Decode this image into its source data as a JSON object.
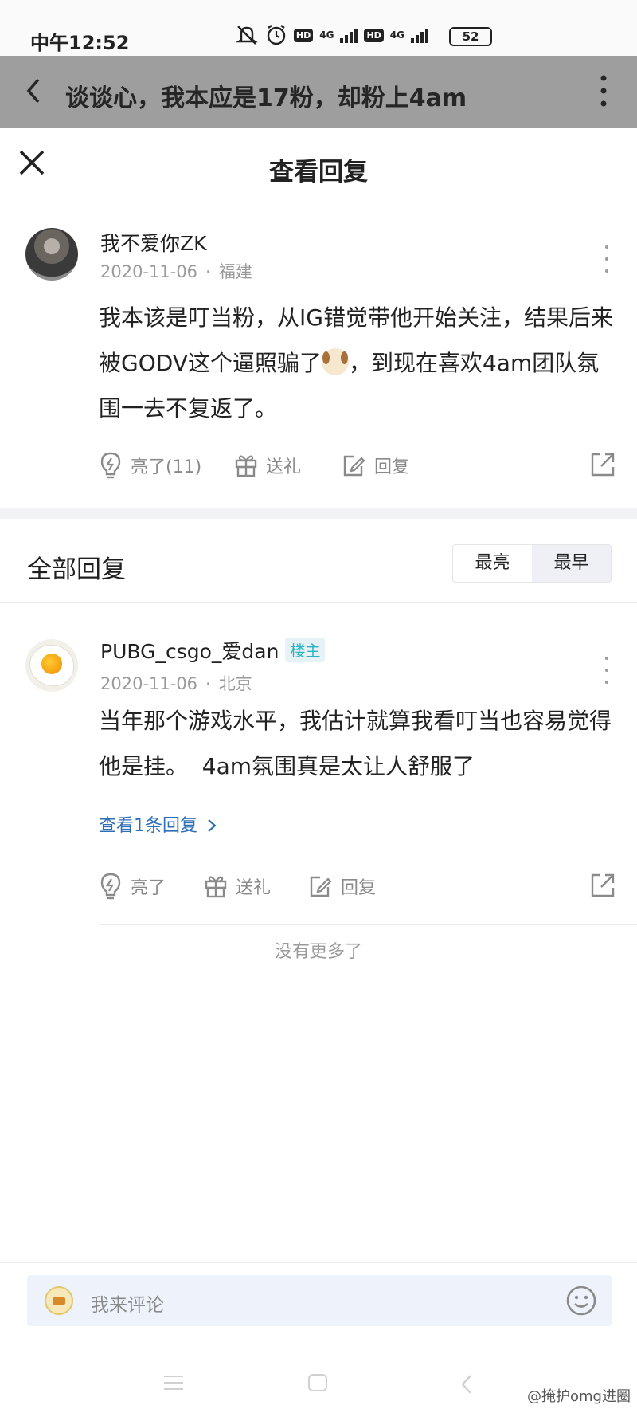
{
  "status_bar": {
    "time": "中午12:52",
    "hd1": "HD",
    "net1": "4G",
    "hd2": "HD",
    "net2": "4G",
    "battery": "52"
  },
  "page_header": {
    "title": "谈谈心，我本应是17粉，却粉上4am"
  },
  "sheet": {
    "title": "查看回复"
  },
  "main_comment": {
    "username": "我不爱你ZK",
    "date": "2020-11-06",
    "location": "福建",
    "text_before_emoji": "我本该是叮当粉，从IG错觉带他开始关注，结果后来被GODV这个逼照骗了",
    "text_after_emoji": "，到现在喜欢4am团队氛围一去不复返了。",
    "like_label": "亮了(11)",
    "gift_label": "送礼",
    "reply_label": "回复"
  },
  "replies_section": {
    "title": "全部回复",
    "sort_options": [
      "最亮",
      "最早"
    ],
    "active_sort": "最早"
  },
  "reply": {
    "username": "PUBG_csgo_爱dan",
    "badge": "楼主",
    "date": "2020-11-06",
    "location": "北京",
    "text": "当年那个游戏水平，我估计就算我看叮当也容易觉得他是挂。  4am氛围真是太让人舒服了",
    "view_replies": "查看1条回复",
    "like_label": "亮了",
    "gift_label": "送礼",
    "reply_label": "回复"
  },
  "no_more": "没有更多了",
  "comment_input": {
    "placeholder": "我来评论"
  },
  "watermark": "@掩护omg进圈",
  "colors": {
    "link_blue": "#2e6fb8",
    "badge_teal": "#2bb3c2",
    "header_dim": "#9e9e9e"
  }
}
